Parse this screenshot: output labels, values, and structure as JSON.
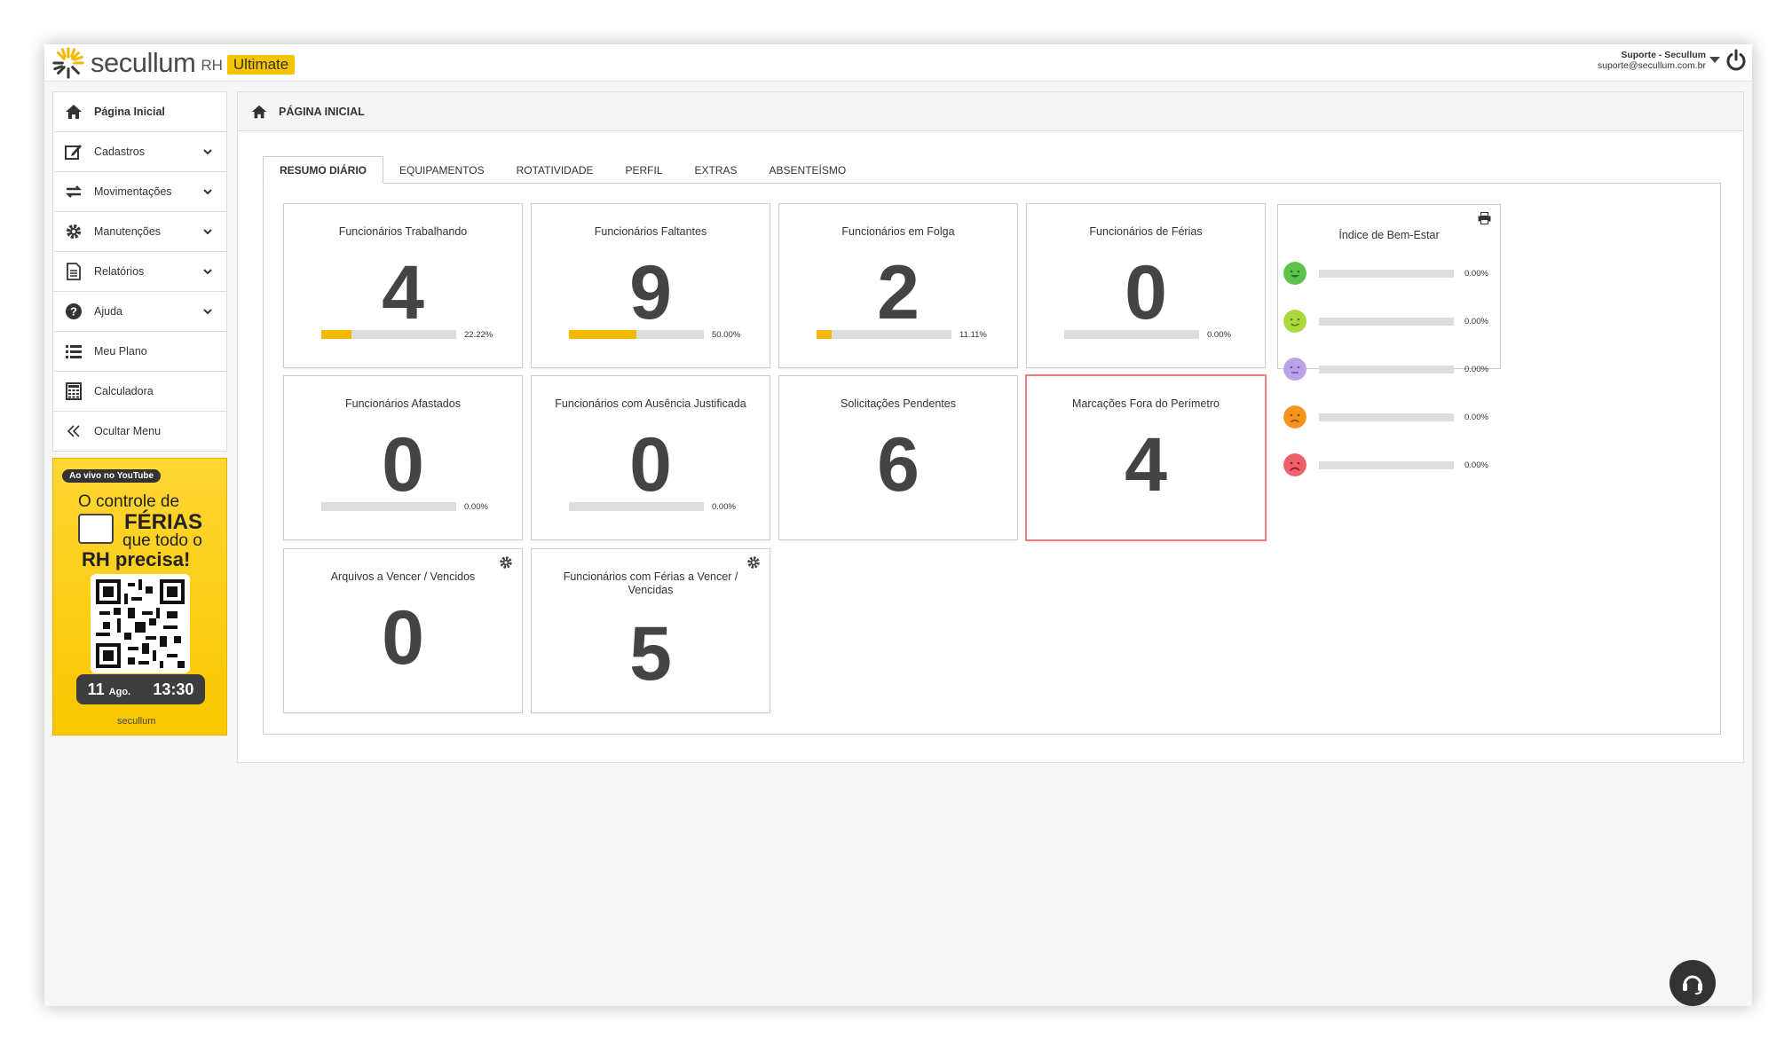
{
  "brand": {
    "name": "secullum",
    "product": "RH",
    "edition": "Ultimate"
  },
  "user": {
    "name": "Suporte - Secullum",
    "email": "suporte@secullum.com.br"
  },
  "sidebar": {
    "items": [
      {
        "label": "Página Inicial",
        "icon": "home-icon"
      },
      {
        "label": "Cadastros",
        "icon": "edit-icon"
      },
      {
        "label": "Movimentações",
        "icon": "swap-icon"
      },
      {
        "label": "Manutenções",
        "icon": "gear-icon"
      },
      {
        "label": "Relatórios",
        "icon": "document-icon"
      },
      {
        "label": "Ajuda",
        "icon": "question-icon"
      },
      {
        "label": "Meu Plano",
        "icon": "list-icon"
      },
      {
        "label": "Calculadora",
        "icon": "calculator-icon"
      },
      {
        "label": "Ocultar Menu",
        "icon": "double-chevron-left-icon"
      }
    ],
    "promo": {
      "badge": "Ao vivo no YouTube",
      "line1": "O controle de",
      "line2": "FÉRIAS",
      "line3": "que todo o",
      "line4": "RH precisa!",
      "date_day": "11",
      "date_month": "Ago.",
      "time": "13:30",
      "brand": "secullum"
    }
  },
  "page": {
    "title": "PÁGINA INICIAL"
  },
  "tabs": [
    "RESUMO DIÁRIO",
    "EQUIPAMENTOS",
    "ROTATIVIDADE",
    "PERFIL",
    "EXTRAS",
    "ABSENTEÍSMO"
  ],
  "cards": [
    {
      "title": "Funcionários Trabalhando",
      "value": "4",
      "percent": 22.22,
      "percent_label": "22.22%"
    },
    {
      "title": "Funcionários Faltantes",
      "value": "9",
      "percent": 50.0,
      "percent_label": "50.00%"
    },
    {
      "title": "Funcionários em Folga",
      "value": "2",
      "percent": 11.11,
      "percent_label": "11.11%"
    },
    {
      "title": "Funcionários de Férias",
      "value": "0",
      "percent": 0,
      "percent_label": "0.00%"
    },
    {
      "title": "Funcionários Afastados",
      "value": "0",
      "percent": 0,
      "percent_label": "0.00%"
    },
    {
      "title": "Funcionários com Ausência Justificada",
      "value": "0",
      "percent": 0,
      "percent_label": "0.00%"
    },
    {
      "title": "Solicitações Pendentes",
      "value": "6"
    },
    {
      "title": "Marcações Fora do Perímetro",
      "value": "4"
    },
    {
      "title": "Arquivos a Vencer / Vencidos",
      "value": "0"
    },
    {
      "title": "Funcionários com Férias a Vencer / Vencidas",
      "value": "5"
    }
  ],
  "wellbeing": {
    "title": "Índice de Bem-Estar",
    "rows": [
      {
        "color": "#5cc24a",
        "percent_label": "0.00%"
      },
      {
        "color": "#a9d93b",
        "percent_label": "0.00%"
      },
      {
        "color": "#b9a3e6",
        "percent_label": "0.00%"
      },
      {
        "color": "#f7941d",
        "percent_label": "0.00%"
      },
      {
        "color": "#f0606a",
        "percent_label": "0.00%"
      }
    ]
  },
  "colors": {
    "accent": "#f5b800",
    "highlight_border": "#e8807e"
  }
}
